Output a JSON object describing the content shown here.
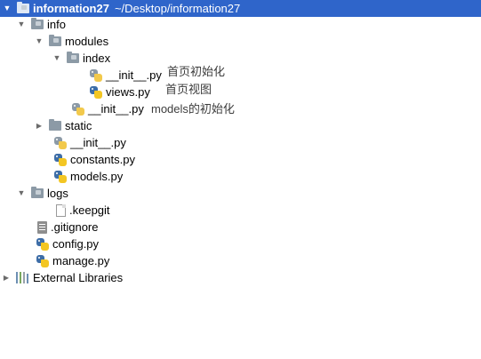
{
  "tree": {
    "project_root_name": "information27",
    "project_root_path": "~/Desktop/information27",
    "info": "info",
    "modules": "modules",
    "index": "index",
    "index_init": "__init__.py",
    "index_views": "views.py",
    "modules_init": "__init__.py",
    "static": "static",
    "info_init": "__init__.py",
    "constants": "constants.py",
    "models": "models.py",
    "logs": "logs",
    "keepgit": ".keepgit",
    "gitignore": ".gitignore",
    "config": "config.py",
    "manage": "manage.py",
    "external_libraries": "External Libraries"
  },
  "annotations": {
    "index_init_note": "首页初始化",
    "views_note": "首页视图",
    "modules_init_note": "models的初始化"
  }
}
